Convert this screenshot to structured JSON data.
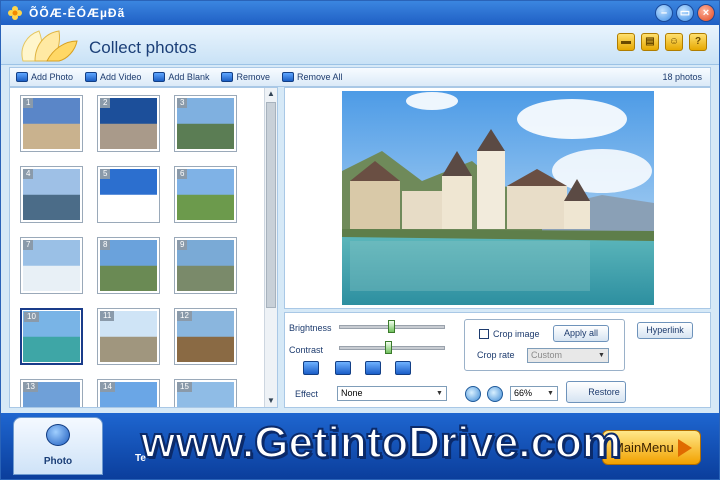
{
  "window": {
    "title": "ÕÕÆ-ÊÓÆµÐã"
  },
  "header": {
    "title": "Collect photos",
    "icons": [
      "folder-icon",
      "save-icon",
      "user-icon",
      "help-icon"
    ]
  },
  "toolbar": {
    "add_photo": "Add Photo",
    "add_video": "Add Video",
    "add_blank": "Add Blank",
    "remove": "Remove",
    "remove_all": "Remove All",
    "count": "18 photos"
  },
  "thumbnails": [
    {
      "num": "1"
    },
    {
      "num": "2"
    },
    {
      "num": "3"
    },
    {
      "num": "4"
    },
    {
      "num": "5"
    },
    {
      "num": "6"
    },
    {
      "num": "7"
    },
    {
      "num": "8"
    },
    {
      "num": "9"
    },
    {
      "num": "10"
    },
    {
      "num": "11"
    },
    {
      "num": "12"
    },
    {
      "num": "13"
    },
    {
      "num": "14"
    },
    {
      "num": "15"
    }
  ],
  "controls": {
    "brightness_label": "Brightness",
    "brightness_level": 0.48,
    "contrast_label": "Contrast",
    "contrast_level": 0.45,
    "crop_label": "Crop image",
    "apply_all": "Apply all",
    "crop_rate_label": "Crop rate",
    "crop_rate_value": "Custom",
    "hyperlink": "Hyperlink",
    "effect_label": "Effect",
    "effect_value": "None",
    "zoom_value": "66%",
    "restore": "Restore"
  },
  "bottom": {
    "photo_tab": "Photo",
    "second_tab": "Te",
    "main_menu": "MainMenu",
    "watermark": "www.GetintoDrive.com"
  },
  "colors": {
    "accent": "#1f5fc4",
    "button_gold": "#f2a100"
  }
}
